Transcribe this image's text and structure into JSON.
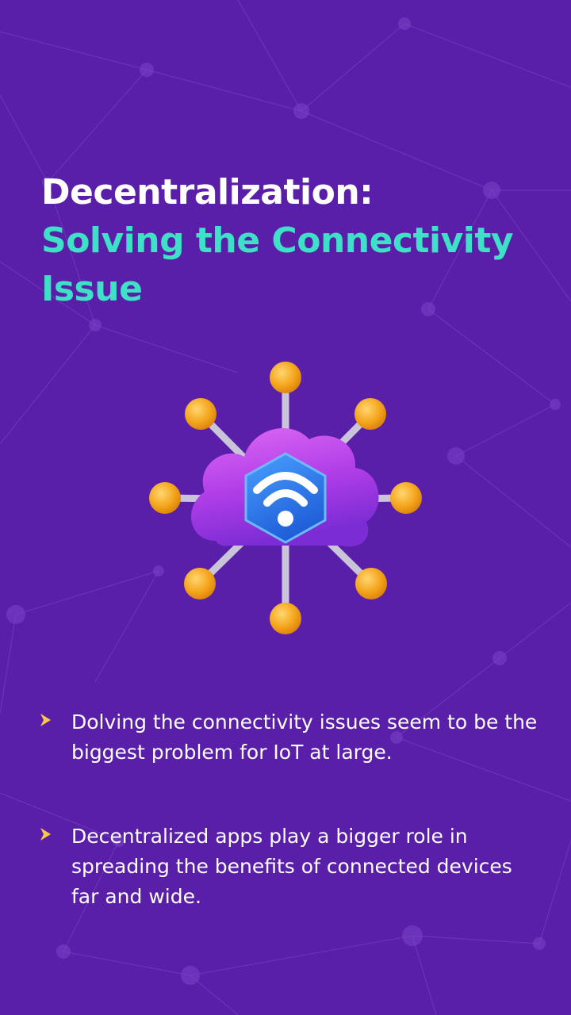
{
  "headline": {
    "line1": "Decentralization:",
    "line2a": "Solving the Connectivity",
    "line2b": "Issue"
  },
  "illustration": {
    "icon": "cloud-network-wifi-icon"
  },
  "bullets": [
    {
      "text": "Dolving the connectivity issues seem to be the biggest problem for IoT at large."
    },
    {
      "text": "Decentralized apps play a bigger role in spreading the benefits of connected devices far and wide."
    }
  ],
  "colors": {
    "background": "#5a1fa8",
    "accent_teal": "#3fe0c8",
    "bullet_yellow": "#f7c948",
    "node_orange": "#f4a51c",
    "cloud_purple": "#b03ee8",
    "hex_blue": "#2f7ce8"
  }
}
